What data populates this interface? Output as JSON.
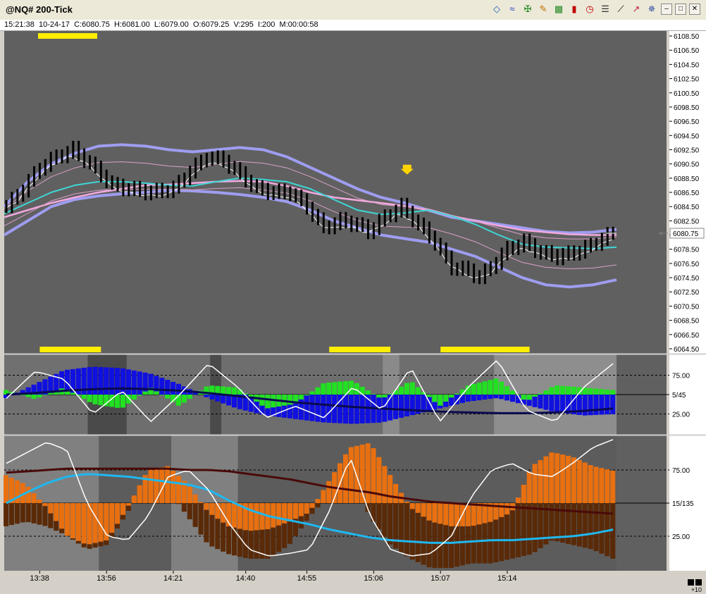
{
  "window": {
    "title": "@NQ# 200-Tick",
    "toolbar_icons": [
      "format-icon",
      "bands-icon",
      "cross-icon",
      "pencil-icon",
      "bar-chart-icon",
      "candlestick-icon",
      "clock-icon",
      "properties-icon",
      "draw-line-icon",
      "trend-icon",
      "dropper-icon"
    ],
    "minimize": "–",
    "restore": "□",
    "close": "✕"
  },
  "info_bar": {
    "time": "15:21:38",
    "date": "10-24-17",
    "close": "C:6080.75",
    "high": "H:6081.00",
    "low": "L:6079.00",
    "open": "O:6079.25",
    "volume": "V:295",
    "interval": "I:200",
    "countdown": "M:00:00:58"
  },
  "chart_data": [
    {
      "type": "line",
      "pane": "price",
      "y_ticks": [
        "6108.50",
        "6106.50",
        "6104.50",
        "6102.50",
        "6100.50",
        "6098.50",
        "6096.50",
        "6094.50",
        "6092.50",
        "6090.50",
        "6088.50",
        "6086.50",
        "6084.50",
        "6082.50",
        "6080.50",
        "6078.50",
        "6076.50",
        "6074.50",
        "6072.50",
        "6070.50",
        "6068.50",
        "6066.50",
        "6064.50"
      ],
      "ylim": [
        6064.0,
        6109.0
      ],
      "last_price_label": "6080.75",
      "last_price": 6080.75,
      "bar_count": 110,
      "close_path": [
        {
          "i": 0,
          "p": 6084.5
        },
        {
          "i": 3,
          "p": 6087.0
        },
        {
          "i": 6,
          "p": 6090.0
        },
        {
          "i": 9,
          "p": 6091.5
        },
        {
          "i": 12,
          "p": 6092.5
        },
        {
          "i": 15,
          "p": 6090.5
        },
        {
          "i": 19,
          "p": 6087.5
        },
        {
          "i": 22,
          "p": 6087.0
        },
        {
          "i": 26,
          "p": 6086.5
        },
        {
          "i": 30,
          "p": 6087.0
        },
        {
          "i": 33,
          "p": 6089.5
        },
        {
          "i": 36,
          "p": 6091.5
        },
        {
          "i": 39,
          "p": 6091.0
        },
        {
          "i": 42,
          "p": 6089.0
        },
        {
          "i": 45,
          "p": 6087.0
        },
        {
          "i": 48,
          "p": 6086.5
        },
        {
          "i": 51,
          "p": 6086.5
        },
        {
          "i": 54,
          "p": 6084.5
        },
        {
          "i": 57,
          "p": 6081.5
        },
        {
          "i": 60,
          "p": 6082.5
        },
        {
          "i": 63,
          "p": 6082.0
        },
        {
          "i": 65,
          "p": 6081.0
        },
        {
          "i": 68,
          "p": 6083.0
        },
        {
          "i": 71,
          "p": 6084.5
        },
        {
          "i": 74,
          "p": 6082.0
        },
        {
          "i": 77,
          "p": 6079.5
        },
        {
          "i": 80,
          "p": 6076.0
        },
        {
          "i": 83,
          "p": 6075.5
        },
        {
          "i": 85,
          "p": 6074.5
        },
        {
          "i": 87,
          "p": 6076.0
        },
        {
          "i": 90,
          "p": 6078.5
        },
        {
          "i": 93,
          "p": 6079.5
        },
        {
          "i": 96,
          "p": 6078.0
        },
        {
          "i": 99,
          "p": 6077.5
        },
        {
          "i": 102,
          "p": 6078.0
        },
        {
          "i": 105,
          "p": 6079.0
        },
        {
          "i": 107,
          "p": 6080.0
        },
        {
          "i": 109,
          "p": 6080.75
        }
      ],
      "band_upper": [
        6084.5,
        6088,
        6090.5,
        6092,
        6093,
        6093.2,
        6093,
        6092.5,
        6092.2,
        6092.5,
        6092.8,
        6092.5,
        6091.5,
        6090,
        6088.5,
        6087,
        6085.8,
        6085,
        6084,
        6083,
        6082.5,
        6082,
        6081.5,
        6081,
        6080.8,
        6080.9,
        6081.3
      ],
      "band_lower": [
        6080.5,
        6082.5,
        6084.5,
        6085.5,
        6086,
        6086.3,
        6086.5,
        6086.8,
        6086.7,
        6086.5,
        6086.2,
        6085.8,
        6085.2,
        6084,
        6082.5,
        6081.5,
        6080.5,
        6080,
        6079.5,
        6078.5,
        6077.5,
        6076,
        6074.5,
        6073.5,
        6073.2,
        6073.5,
        6074.2
      ],
      "pink_ma": [
        6083,
        6084,
        6085,
        6085.8,
        6086.5,
        6087,
        6087.5,
        6087.6,
        6087.8,
        6088,
        6088.1,
        6088,
        6087.4,
        6086.5,
        6085.8,
        6085.4,
        6085,
        6084.6,
        6084,
        6083.2,
        6082.5,
        6081.8,
        6081.2,
        6080.9,
        6080.6,
        6080.5,
        6080.5
      ],
      "cyan_ma": [
        6083.5,
        6085,
        6086.5,
        6087.5,
        6088,
        6088,
        6087.8,
        6087.5,
        6087.4,
        6088,
        6088.5,
        6088.3,
        6088,
        6087,
        6085.5,
        6084,
        6083.4,
        6083.6,
        6084,
        6083.2,
        6082,
        6080.5,
        6079.2,
        6078.8,
        6078.7,
        6078.6,
        6078.8
      ],
      "annotations": {
        "down_arrow_index": 72,
        "down_arrow_price": 6089.8
      },
      "signal_markers": [
        {
          "from": 6,
          "to": 17
        },
        {
          "from": 58,
          "to": 69
        },
        {
          "from": 78,
          "to": 94
        }
      ]
    },
    {
      "type": "bar",
      "pane": "oscillator-1",
      "y_ticks": [
        "75.00",
        "5/45",
        "25.00"
      ],
      "ylim": [
        0,
        100
      ],
      "reference_levels": [
        75,
        50,
        25
      ],
      "bar_count": 110,
      "histogram_blue": [
        -5,
        15,
        35,
        40,
        38,
        30,
        15,
        -5,
        -20,
        -30,
        -35,
        -40,
        -42,
        -40,
        -30,
        -20,
        -10,
        -5,
        -15,
        -25,
        -30,
        -28
      ],
      "histogram_green": [
        10,
        -10,
        15,
        -20,
        -30,
        15,
        -25,
        20,
        15,
        -30,
        -20,
        25,
        30,
        -10,
        30,
        -25,
        20,
        35,
        -15,
        20,
        15,
        10
      ],
      "white_line": [
        45,
        80,
        70,
        25,
        55,
        15,
        50,
        90,
        60,
        20,
        35,
        20,
        60,
        30,
        85,
        15,
        60,
        95,
        30,
        15,
        60,
        90
      ],
      "navy_line": [
        50,
        52,
        55,
        57,
        58,
        57,
        55,
        52,
        48,
        44,
        40,
        37,
        34,
        32,
        30,
        28,
        27,
        26,
        26,
        27,
        29,
        32
      ]
    },
    {
      "type": "bar",
      "pane": "oscillator-2",
      "y_ticks": [
        "75.00",
        "15/135",
        "25.00"
      ],
      "ylim": [
        0,
        100
      ],
      "reference_levels": [
        75,
        50,
        25
      ],
      "bar_count": 110,
      "histogram_orange": [
        30,
        20,
        -5,
        -35,
        -45,
        -40,
        -5,
        35,
        40,
        20,
        -10,
        -25,
        -30,
        -28,
        -20,
        -10,
        25,
        60,
        65,
        30,
        -5,
        -20,
        -25,
        -25,
        -20,
        -10,
        40,
        55,
        50,
        40,
        35
      ],
      "histogram_dark": [
        -25,
        -20,
        -25,
        -35,
        -50,
        -45,
        -10,
        20,
        15,
        -15,
        -45,
        -55,
        -60,
        -60,
        -45,
        -15,
        10,
        35,
        -15,
        -45,
        -60,
        -70,
        -70,
        -65,
        -65,
        -60,
        -55,
        -40,
        -45,
        -50,
        -60
      ],
      "white_line": [
        80,
        88,
        96,
        90,
        50,
        25,
        22,
        40,
        70,
        75,
        60,
        35,
        15,
        10,
        12,
        15,
        45,
        85,
        40,
        15,
        10,
        12,
        25,
        55,
        75,
        80,
        72,
        70,
        80,
        92,
        98
      ],
      "maroon_line": [
        73,
        74,
        75,
        76,
        76,
        76,
        76,
        76,
        76,
        75,
        75,
        74,
        72,
        70,
        68,
        65,
        62,
        60,
        58,
        55,
        53,
        51,
        50,
        49,
        48,
        47,
        46,
        45,
        44,
        43,
        42
      ],
      "cyan_line": [
        50,
        58,
        65,
        70,
        72,
        71,
        70,
        68,
        66,
        64,
        60,
        52,
        45,
        40,
        37,
        34,
        30,
        27,
        24,
        22,
        21,
        20,
        20,
        21,
        22,
        22,
        23,
        24,
        25,
        27,
        30
      ]
    }
  ],
  "x_axis": {
    "tick_labels": [
      "13:38",
      "13:56",
      "14:21",
      "14:40",
      "14:55",
      "15:06",
      "15:07",
      "15:14"
    ],
    "tick_indexes": [
      6,
      18,
      30,
      43,
      54,
      66,
      78,
      90
    ]
  },
  "footer": {
    "zoom_label": "+10"
  }
}
